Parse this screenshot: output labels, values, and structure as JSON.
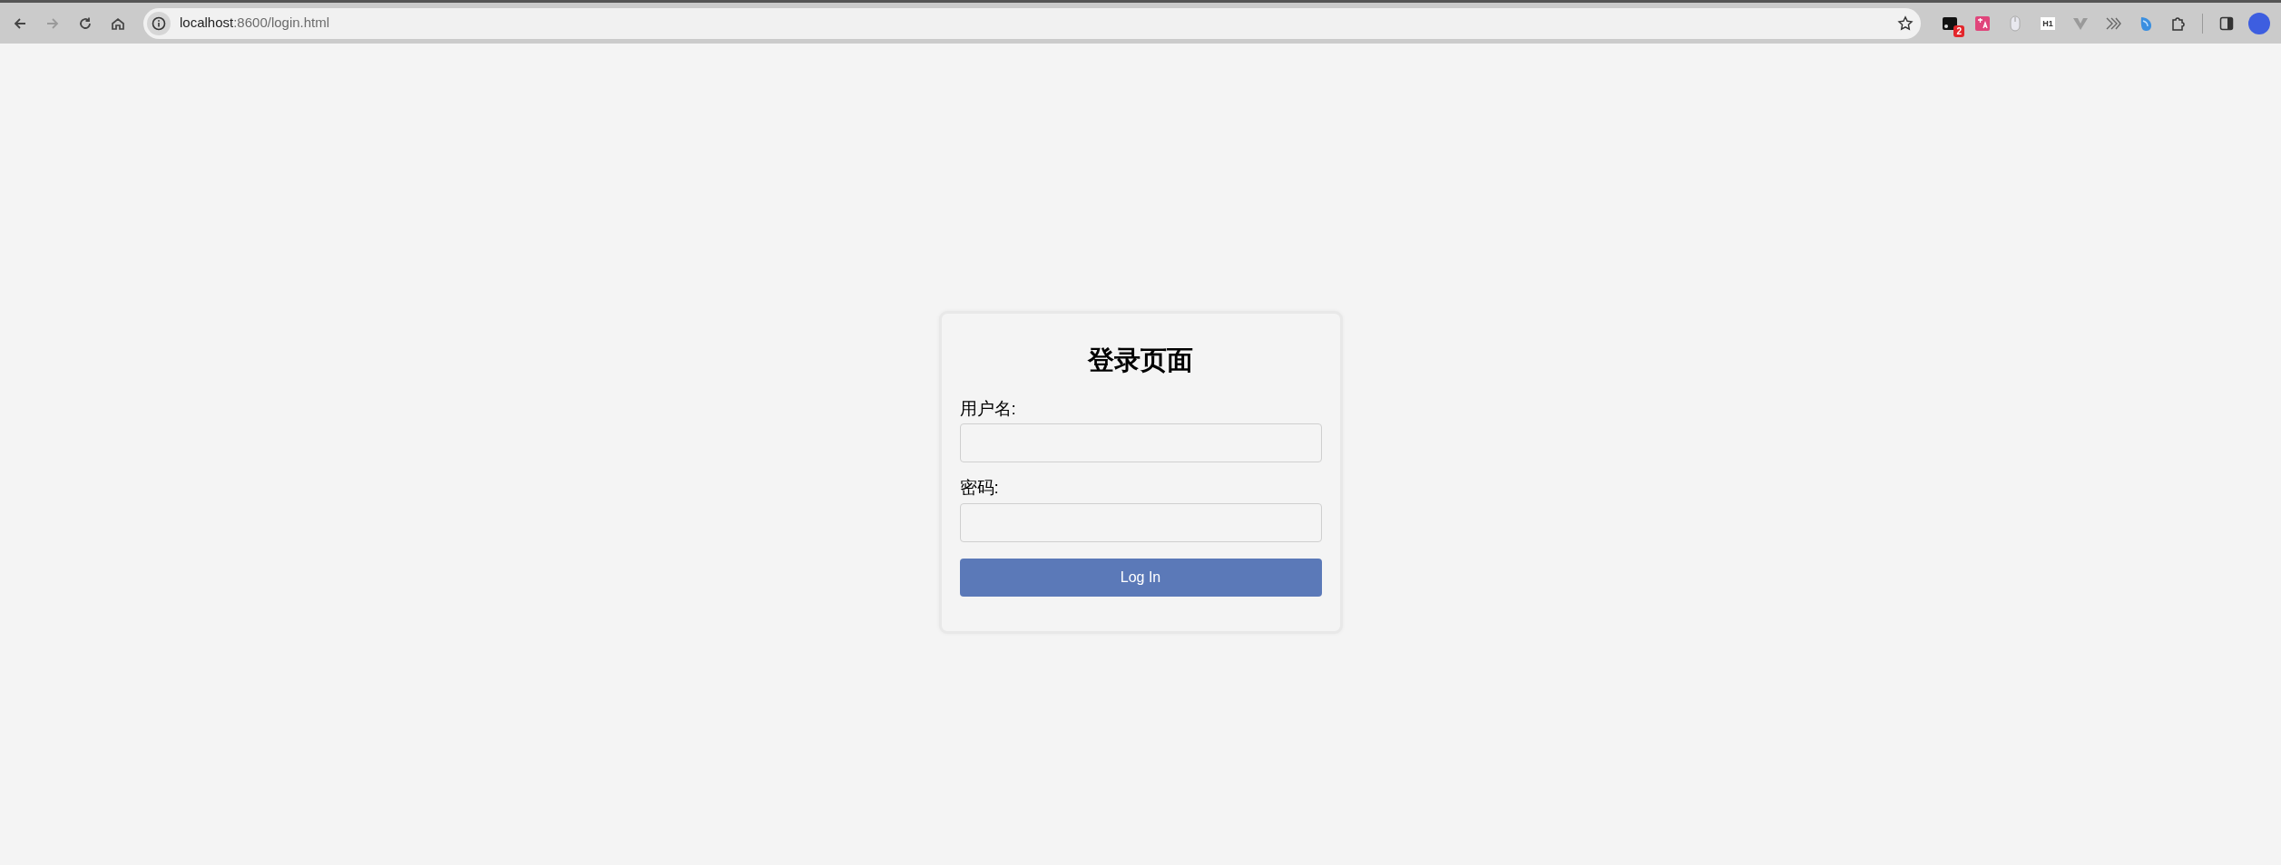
{
  "browser": {
    "nav_buttons": [
      {
        "kind": "back",
        "disabled": false
      },
      {
        "kind": "forward",
        "disabled": true
      },
      {
        "kind": "reload",
        "disabled": false
      },
      {
        "kind": "home",
        "disabled": false
      }
    ],
    "url": {
      "host": "localhost",
      "path": ":8600/login.html"
    },
    "extensions": [
      {
        "kind": "badge",
        "badge": "2"
      },
      {
        "kind": "translate"
      },
      {
        "kind": "mouse"
      },
      {
        "kind": "label",
        "label": "H1"
      },
      {
        "kind": "v"
      },
      {
        "kind": "chevrons"
      },
      {
        "kind": "blue"
      },
      {
        "kind": "puzzle"
      }
    ]
  },
  "login": {
    "title": "登录页面",
    "fields": [
      {
        "label": "用户名:"
      },
      {
        "label": "密码:"
      }
    ],
    "button": "Log In"
  }
}
